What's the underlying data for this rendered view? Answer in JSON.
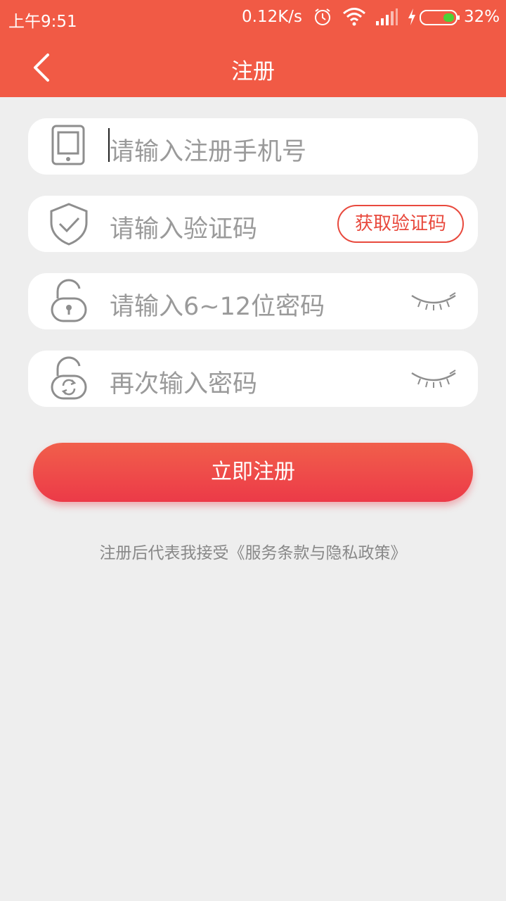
{
  "status_bar": {
    "time": "上午9:51",
    "net_speed": "0.12K/s",
    "battery_percent": "32%",
    "icons": [
      "alarm-icon",
      "wifi-icon",
      "signal-icon",
      "charging-icon",
      "battery-icon"
    ]
  },
  "app_bar": {
    "title": "注册",
    "back_icon": "chevron-left-icon"
  },
  "form": {
    "phone": {
      "placeholder": "请输入注册手机号",
      "icon": "phone-icon"
    },
    "code": {
      "placeholder": "请输入验证码",
      "icon": "shield-check-icon",
      "button_label": "获取验证码"
    },
    "password": {
      "placeholder": "请输入6~12位密码",
      "icon": "lock-icon",
      "toggle_icon": "eye-closed-icon"
    },
    "confirm_password": {
      "placeholder": "再次输入密码",
      "icon": "lock-refresh-icon",
      "toggle_icon": "eye-closed-icon"
    }
  },
  "register_button": "立即注册",
  "terms_text": "注册后代表我接受《服务条款与隐私政策》",
  "colors": {
    "accent": "#f15a45",
    "button_gradient_end": "#ec3a48",
    "background": "#eeeeee"
  }
}
